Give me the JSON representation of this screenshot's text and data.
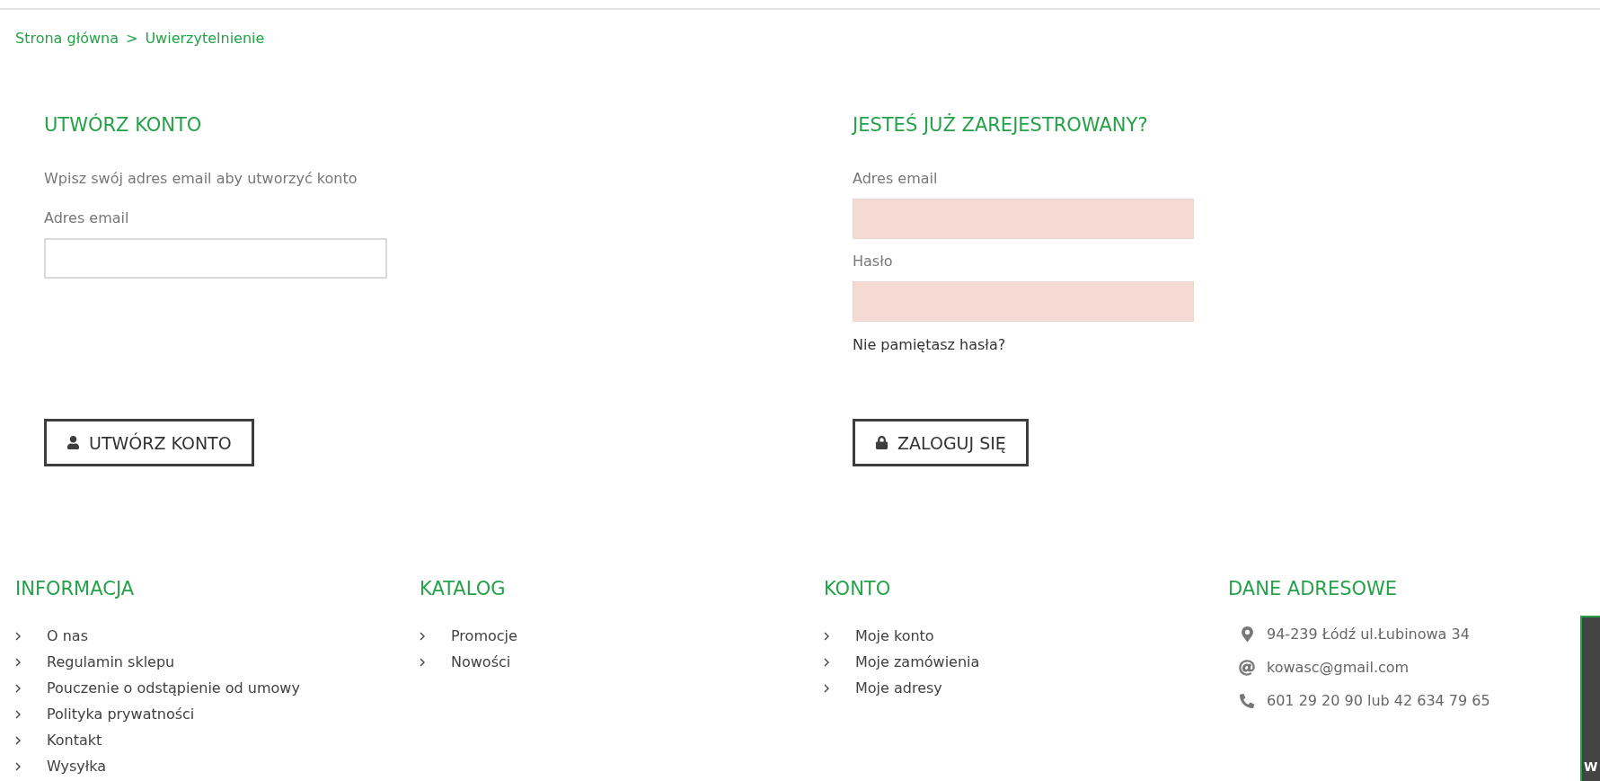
{
  "breadcrumb": {
    "items": [
      "Strona główna",
      "Uwierzytelnienie"
    ],
    "separator": ">"
  },
  "create_account": {
    "title": "UTWÓRZ KONTO",
    "description": "Wpisz swój adres email aby utworzyć konto",
    "fields": [
      {
        "label": "Adres email",
        "highlighted": false
      }
    ],
    "button": "UTWÓRZ KONTO"
  },
  "login": {
    "title": "JESTEŚ JUŻ ZAREJESTROWANY?",
    "fields": [
      {
        "label": "Adres email",
        "highlighted": true
      },
      {
        "label": "Hasło",
        "highlighted": true
      }
    ],
    "forgot_link": "Nie pamiętasz hasła?",
    "button": "ZALOGUJ SIĘ"
  },
  "footer": {
    "columns": [
      {
        "title": "INFORMACJA",
        "links": [
          "O nas",
          "Regulamin sklepu",
          "Pouczenie o odstąpienie od umowy",
          "Polityka prywatności",
          "Kontakt",
          "Wysyłka"
        ]
      },
      {
        "title": "KATALOG",
        "links": [
          "Promocje",
          "Nowości"
        ]
      },
      {
        "title": "KONTO",
        "links": [
          "Moje konto",
          "Moje zamówienia",
          "Moje adresy"
        ]
      }
    ],
    "contact": {
      "title": "DANE ADRESOWE",
      "items": [
        {
          "kind": "address",
          "text": "94-239 Łódź ul.Łubinowa 34"
        },
        {
          "kind": "email",
          "text": "kowasc@gmail.com"
        },
        {
          "kind": "phone",
          "text": "601 29 20 90 lub 42 634 79 65"
        }
      ]
    }
  },
  "corner_panel": {
    "text": "W"
  }
}
